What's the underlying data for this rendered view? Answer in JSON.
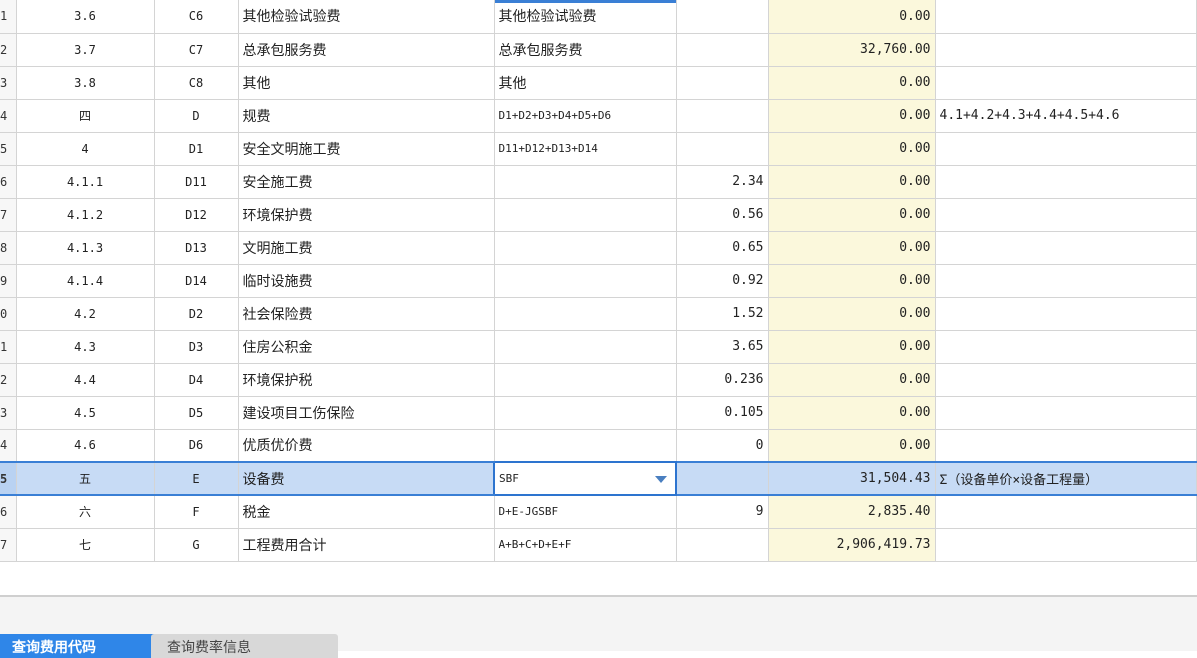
{
  "rows": [
    {
      "rn": "1",
      "no": "3.6",
      "code": "C6",
      "name": "其他检验试验费",
      "base": "其他检验试验费",
      "rate": "",
      "amount": "0.00",
      "note": ""
    },
    {
      "rn": "2",
      "no": "3.7",
      "code": "C7",
      "name": "总承包服务费",
      "base": "总承包服务费",
      "rate": "",
      "amount": "32,760.00",
      "note": ""
    },
    {
      "rn": "3",
      "no": "3.8",
      "code": "C8",
      "name": "其他",
      "base": "其他",
      "rate": "",
      "amount": "0.00",
      "note": ""
    },
    {
      "rn": "4",
      "no": "四",
      "code": "D",
      "name": "规费",
      "base": "D1+D2+D3+D4+D5+D6",
      "rate": "",
      "amount": "0.00",
      "note": "4.1+4.2+4.3+4.4+4.5+4.6"
    },
    {
      "rn": "5",
      "no": "4",
      "code": "D1",
      "name": "安全文明施工费",
      "base": "D11+D12+D13+D14",
      "rate": "",
      "amount": "0.00",
      "note": ""
    },
    {
      "rn": "6",
      "no": "4.1.1",
      "code": "D11",
      "name": "安全施工费",
      "base": "",
      "rate": "2.34",
      "amount": "0.00",
      "note": ""
    },
    {
      "rn": "7",
      "no": "4.1.2",
      "code": "D12",
      "name": "环境保护费",
      "base": "",
      "rate": "0.56",
      "amount": "0.00",
      "note": ""
    },
    {
      "rn": "8",
      "no": "4.1.3",
      "code": "D13",
      "name": "文明施工费",
      "base": "",
      "rate": "0.65",
      "amount": "0.00",
      "note": ""
    },
    {
      "rn": "9",
      "no": "4.1.4",
      "code": "D14",
      "name": "临时设施费",
      "base": "",
      "rate": "0.92",
      "amount": "0.00",
      "note": ""
    },
    {
      "rn": "0",
      "no": "4.2",
      "code": "D2",
      "name": "社会保险费",
      "base": "",
      "rate": "1.52",
      "amount": "0.00",
      "note": ""
    },
    {
      "rn": "1",
      "no": "4.3",
      "code": "D3",
      "name": "住房公积金",
      "base": "",
      "rate": "3.65",
      "amount": "0.00",
      "note": ""
    },
    {
      "rn": "2",
      "no": "4.4",
      "code": "D4",
      "name": "环境保护税",
      "base": "",
      "rate": "0.236",
      "amount": "0.00",
      "note": ""
    },
    {
      "rn": "3",
      "no": "4.5",
      "code": "D5",
      "name": "建设项目工伤保险",
      "base": "",
      "rate": "0.105",
      "amount": "0.00",
      "note": ""
    },
    {
      "rn": "4",
      "no": "4.6",
      "code": "D6",
      "name": "优质优价费",
      "base": "",
      "rate": "0",
      "amount": "0.00",
      "note": ""
    },
    {
      "rn": "5",
      "no": "五",
      "code": "E",
      "name": "设备费",
      "base": "SBF",
      "rate": "",
      "amount": "31,504.43",
      "note": "Σ（设备单价×设备工程量）"
    },
    {
      "rn": "6",
      "no": "六",
      "code": "F",
      "name": "税金",
      "base": "D+E-JGSBF",
      "rate": "9",
      "amount": "2,835.40",
      "note": ""
    },
    {
      "rn": "7",
      "no": "七",
      "code": "G",
      "name": "工程费用合计",
      "base": "A+B+C+D+E+F",
      "rate": "",
      "amount": "2,906,419.73",
      "note": ""
    }
  ],
  "tabs": {
    "active": "查询费用代码",
    "inactive": "查询费率信息"
  }
}
